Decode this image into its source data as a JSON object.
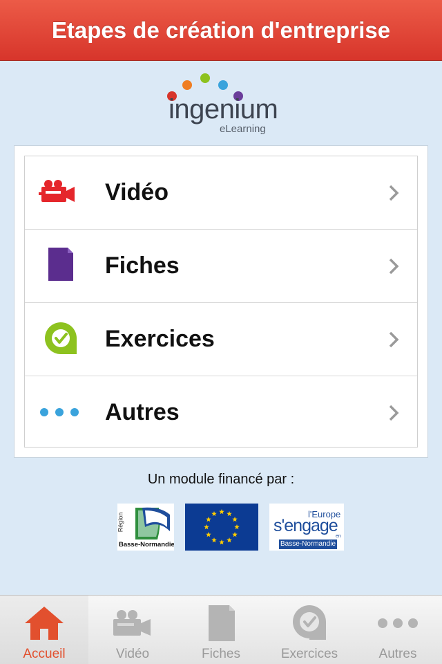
{
  "header": {
    "title": "Etapes de création d'entreprise"
  },
  "logo": {
    "word": "ingenium",
    "sub": "eLearning"
  },
  "menu": {
    "items": [
      {
        "label": "Vidéo",
        "icon": "video-camera-icon"
      },
      {
        "label": "Fiches",
        "icon": "document-icon"
      },
      {
        "label": "Exercices",
        "icon": "check-bubble-icon"
      },
      {
        "label": "Autres",
        "icon": "more-dots-icon"
      }
    ]
  },
  "funding": {
    "text": "Un module financé par :",
    "sponsors": [
      {
        "name": "Région Basse-Normandie",
        "logo_text": "Basse-Normandie",
        "vertical_text": "Région"
      },
      {
        "name": "European Union flag"
      },
      {
        "name": "L'Europe s'engage en Basse-Normandie",
        "line1": "l'Europe",
        "line2": "s'engage",
        "line3": "en",
        "line4": "Basse-Normandie"
      }
    ]
  },
  "tabs": [
    {
      "label": "Accueil",
      "icon": "home-icon",
      "active": true
    },
    {
      "label": "Vidéo",
      "icon": "video-camera-icon",
      "active": false
    },
    {
      "label": "Fiches",
      "icon": "document-icon",
      "active": false
    },
    {
      "label": "Exercices",
      "icon": "check-bubble-icon",
      "active": false
    },
    {
      "label": "Autres",
      "icon": "more-dots-icon",
      "active": false
    }
  ],
  "colors": {
    "header": "#d7352b",
    "video": "#e5262b",
    "fiches": "#5b2d8e",
    "exercices": "#8dc21f",
    "autres": "#3aa3dc",
    "active_tab": "#e2502e"
  }
}
